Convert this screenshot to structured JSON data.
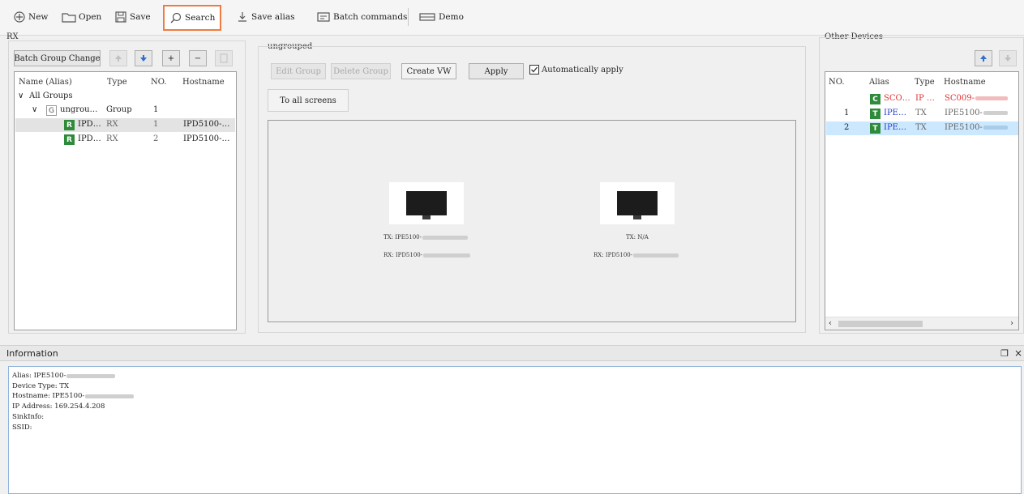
{
  "toolbar": {
    "new": "New",
    "open": "Open",
    "save": "Save",
    "search": "Search",
    "save_alias": "Save alias",
    "batch_commands": "Batch commands",
    "demo": "Demo"
  },
  "left_panel": {
    "title": "RX",
    "batch_group_change": "Batch Group Change",
    "plus": "+",
    "minus": "−",
    "headers": {
      "name": "Name (Alias)",
      "type": "Type",
      "no": "NO.",
      "hostname": "Hostname"
    },
    "tree": [
      {
        "name": "All Groups",
        "type": "",
        "no": "",
        "hostname": ""
      },
      {
        "badge": "G",
        "name": "ungrou…",
        "type": "Group",
        "no": "1",
        "hostname": ""
      },
      {
        "badge": "R",
        "name": "IPD…",
        "type": "RX",
        "no": "1",
        "hostname": "IPD5100-…"
      },
      {
        "badge": "R",
        "name": "IPD…",
        "type": "RX",
        "no": "2",
        "hostname": "IPD5100-…"
      }
    ]
  },
  "center": {
    "group_title": "ungrouped",
    "edit_group": "Edit Group",
    "delete_group": "Delete Group",
    "create_vw": "Create VW",
    "apply": "Apply",
    "auto_apply": "Automatically apply",
    "to_all_screens": "To all screens",
    "screens": [
      {
        "tx": "TX: IPE5100-",
        "rx": "RX: IPD5100-"
      },
      {
        "tx": "TX: N/A",
        "rx": "RX: IPD5100-"
      }
    ]
  },
  "right_panel": {
    "title": "Other Devices",
    "headers": {
      "no": "NO.",
      "alias": "Alias",
      "type": "Type",
      "hostname": "Hostname"
    },
    "rows": [
      {
        "no": "",
        "badge": "C",
        "alias": "SCO…",
        "type": "IP …",
        "hostname": "SC009-"
      },
      {
        "no": "1",
        "badge": "T",
        "alias": "IPE…",
        "type": "TX",
        "hostname": "IPE5100-"
      },
      {
        "no": "2",
        "badge": "T",
        "alias": "IPE…",
        "type": "TX",
        "hostname": "IPE5100-"
      }
    ]
  },
  "info": {
    "title": "Information",
    "float_icon": "float-icon",
    "close_icon": "close-icon",
    "lines": {
      "alias": "Alias: IPE5100-",
      "device_type": "Device Type: TX",
      "hostname": "Hostname: IPE5100-",
      "ip": "IP Address: 169.254.4.208",
      "sinkinfo": "SinkInfo:",
      "ssid": "SSID:"
    }
  },
  "colors": {
    "highlight": "#f07b3f",
    "selection": "#cce8ff",
    "badge_green": "#2e8b3a",
    "red_text": "#e03030",
    "blue_text": "#1f3cc9"
  }
}
